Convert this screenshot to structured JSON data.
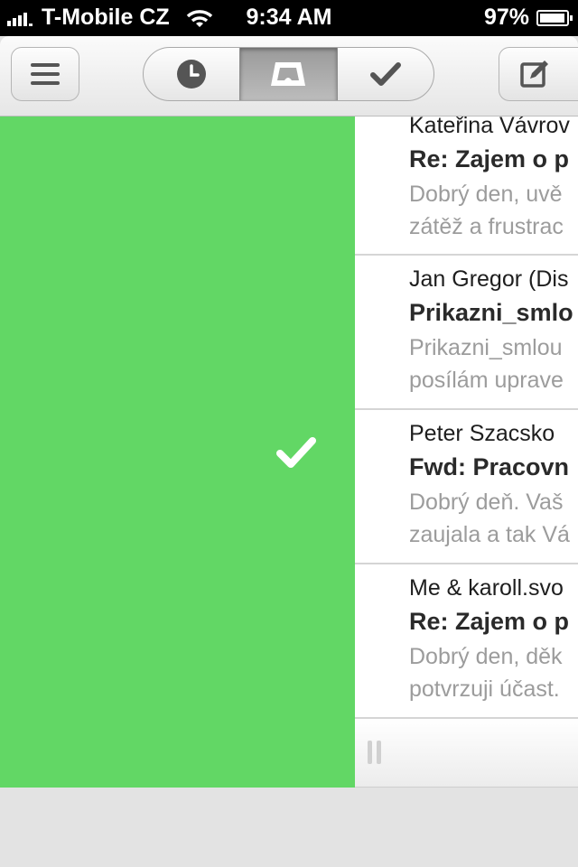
{
  "status_bar": {
    "carrier": "T-Mobile CZ",
    "time": "9:34 AM",
    "battery": "97%",
    "battery_level": 0.97
  },
  "nav": {
    "menu_icon": "hamburger-menu-icon",
    "segments": [
      {
        "icon": "clock-icon",
        "selected": false
      },
      {
        "icon": "inbox-tray-icon",
        "selected": true
      },
      {
        "icon": "checkmark-icon",
        "selected": false
      }
    ],
    "compose_icon": "compose-icon"
  },
  "swipe_action": {
    "icon": "checkmark-icon",
    "color": "#62d765"
  },
  "emails": [
    {
      "from": "Kateřina Vávrov",
      "subject": "Re: Zajem o p",
      "preview_line1": "Dobrý den, uvě",
      "preview_line2": "zátěž a frustrac"
    },
    {
      "from": "Jan Gregor (Dis",
      "subject": "Prikazni_smlo",
      "preview_line1": "Prikazni_smlou",
      "preview_line2": "posílám uprave"
    },
    {
      "from": "Peter Szacsko",
      "subject": "Fwd: Pracovn",
      "preview_line1": "Dobrý deň. Vaš",
      "preview_line2": "zaujala a tak Vá"
    },
    {
      "from": "Me & karoll.svo",
      "subject": "Re: Zajem o p",
      "preview_line1": "Dobrý den, děk",
      "preview_line2": "potvrzuji účast."
    }
  ],
  "colors": {
    "swipe_green": "#62d765",
    "preview_gray": "#9c9c9c"
  }
}
